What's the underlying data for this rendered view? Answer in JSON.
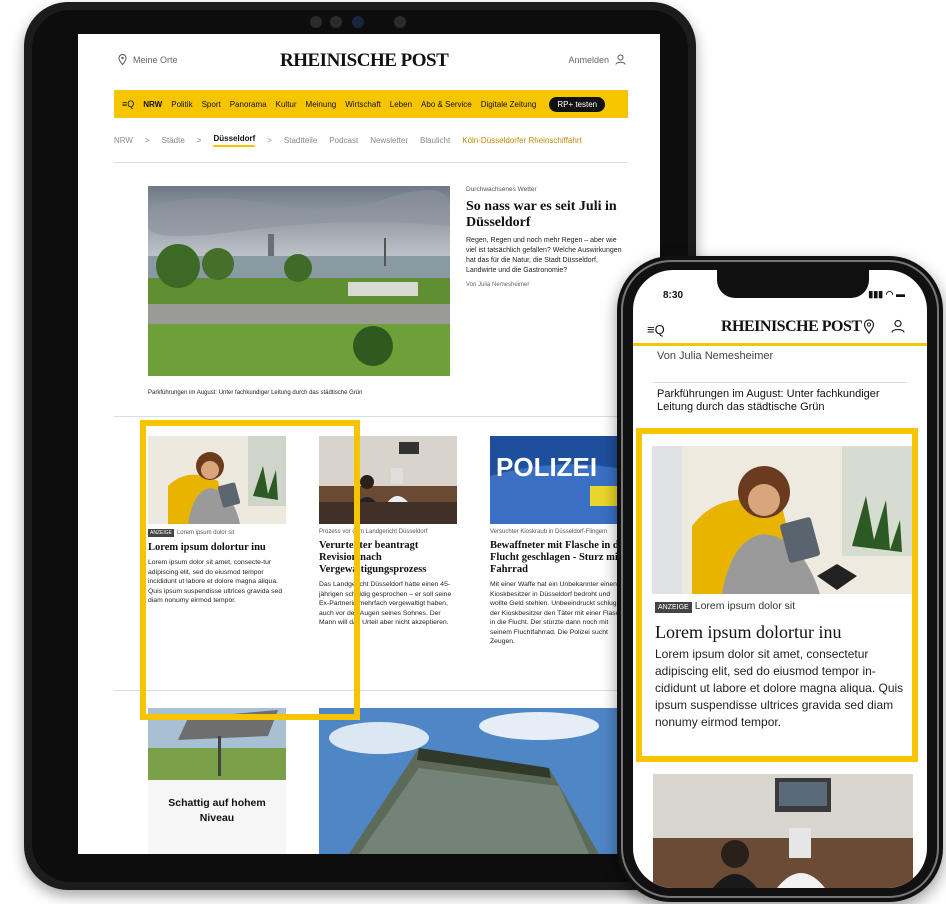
{
  "tablet": {
    "location": "Meine Orte",
    "logo": "RHEINISCHE POST",
    "login": "Anmelden",
    "nav_menu": "≡Q",
    "nav": [
      "NRW",
      "Politik",
      "Sport",
      "Panorama",
      "Kultur",
      "Meinung",
      "Wirtschaft",
      "Leben",
      "Abo & Service",
      "Digitale Zeitung"
    ],
    "nav_cta": "RP+ testen",
    "breadcrumb": [
      "NRW",
      ">",
      "Städte",
      ">",
      "Düsseldorf",
      ">",
      "Stadtteile",
      "Podcast",
      "Newsletter",
      "Blaulicht",
      "Köln-Düsseldorfer Rheinschiffahrt"
    ],
    "hero": {
      "kicker": "Durchwachsenes Wetter",
      "title": "So nass war es seit Juli in Düsseldorf",
      "text": "Regen, Regen und noch mehr Regen – aber wie viel ist tatsächlich gefallen? Welche Auswirkungen hat das für die Natur, die Stadt Düsseldorf, Landwirte und die Gastronomie?",
      "byline": "Von Julia Nemesheimer",
      "caption": "Parkführungen im August: Unter fachkundiger Leitung durch das städtische Grün"
    },
    "cards": [
      {
        "tag": "ANZEIGE",
        "kicker": "Lorem ipsum dolor sit",
        "title": "Lorem ipsum dolortur inu",
        "text": "Lorem ipsum dolor sit amet, consecte-tur adipiscing elit, sed do eiusmod tempor incididunt ut labore et dolore magna aliqua. Quis ipsum suspendisse ultrices gravida sed diam nonumy eirmod tempor."
      },
      {
        "kicker": "Prozess vor dem Landgericht Düsseldorf",
        "title": "Verurteilter beantragt Revision nach Vergewaltigungsprozess",
        "text": "Das Landgericht Düsseldorf hatte einen 45-jährigen schuldig gesprochen – er soll seine Ex-Partnerin mehrfach vergewaltigt haben, auch vor den Augen seines Sohnes. Der Mann will das Urteil aber nicht akzeptieren."
      },
      {
        "kicker": "Versuchter Kioskraub in Düsseldorf-Flingern",
        "title": "Bewaffneter mit Flasche in die Flucht geschlagen - Sturz mit Fahrrad",
        "text": "Mit einer Waffe hat ein Unbekannter einen Kioskbesitzer in Düsseldorf bedroht und wollte Geld stehlen. Unbeeindruckt schlug der Kioskbesitzer den Täter mit einer Flasche in die Flucht. Der stürzte dann noch mit seinem Fluchtfahrrad. Die Polizei sucht Zeugen."
      }
    ],
    "ad2": {
      "title": "Schattig auf hohem Niveau"
    },
    "police_sign": "POLIZEI"
  },
  "phone": {
    "time": "8:30",
    "status": "▮▮▮ ◠ ▬",
    "menu": "≡Q",
    "logo": "RHEINISCHE POST",
    "byline": "Von Julia Nemesheimer",
    "link": "Parkführungen im August: Unter fachkundiger Leitung durch das städtische Grün",
    "card": {
      "tag": "ANZEIGE",
      "kicker": "Lorem ipsum dolor sit",
      "title": "Lorem ipsum dolortur inu",
      "text": "Lorem ipsum dolor sit amet, consectetur adipiscing elit, sed do eiusmod tempor in-cididunt ut labore et dolore magna aliqua. Quis ipsum suspendisse ultrices gravida sed diam nonumy eirmod tempor."
    }
  },
  "colors": {
    "accent": "#f7c500",
    "text": "#111111",
    "device": "#1c1c1e"
  }
}
